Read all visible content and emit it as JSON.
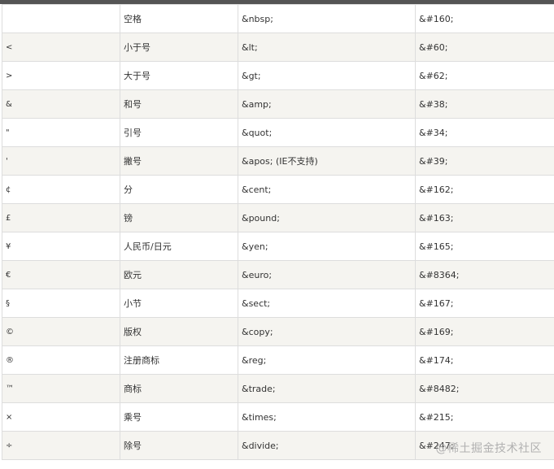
{
  "rows": [
    {
      "symbol": "",
      "description": "空格",
      "entity_name": "&nbsp;",
      "entity_number": "&#160;"
    },
    {
      "symbol": "<",
      "description": "小于号",
      "entity_name": "&lt;",
      "entity_number": "&#60;"
    },
    {
      "symbol": ">",
      "description": "大于号",
      "entity_name": "&gt;",
      "entity_number": "&#62;"
    },
    {
      "symbol": "&",
      "description": "和号",
      "entity_name": "&amp;",
      "entity_number": "&#38;"
    },
    {
      "symbol": "\"",
      "description": "引号",
      "entity_name": "&quot;",
      "entity_number": "&#34;"
    },
    {
      "symbol": "'",
      "description": "撇号",
      "entity_name": "&apos; (IE不支持)",
      "entity_number": "&#39;"
    },
    {
      "symbol": "¢",
      "description": "分",
      "entity_name": "&cent;",
      "entity_number": "&#162;"
    },
    {
      "symbol": "£",
      "description": "镑",
      "entity_name": "&pound;",
      "entity_number": "&#163;"
    },
    {
      "symbol": "¥",
      "description": "人民币/日元",
      "entity_name": "&yen;",
      "entity_number": "&#165;"
    },
    {
      "symbol": "€",
      "description": "欧元",
      "entity_name": "&euro;",
      "entity_number": "&#8364;"
    },
    {
      "symbol": "§",
      "description": "小节",
      "entity_name": "&sect;",
      "entity_number": "&#167;"
    },
    {
      "symbol": "©",
      "description": "版权",
      "entity_name": "&copy;",
      "entity_number": "&#169;"
    },
    {
      "symbol": "®",
      "description": "注册商标",
      "entity_name": "&reg;",
      "entity_number": "&#174;"
    },
    {
      "symbol": "™",
      "description": "商标",
      "entity_name": "&trade;",
      "entity_number": "&#8482;"
    },
    {
      "symbol": "×",
      "description": "乘号",
      "entity_name": "&times;",
      "entity_number": "&#215;"
    },
    {
      "symbol": "÷",
      "description": "除号",
      "entity_name": "&divide;",
      "entity_number": "&#247;"
    }
  ],
  "watermark": "@稀土掘金技术社区"
}
